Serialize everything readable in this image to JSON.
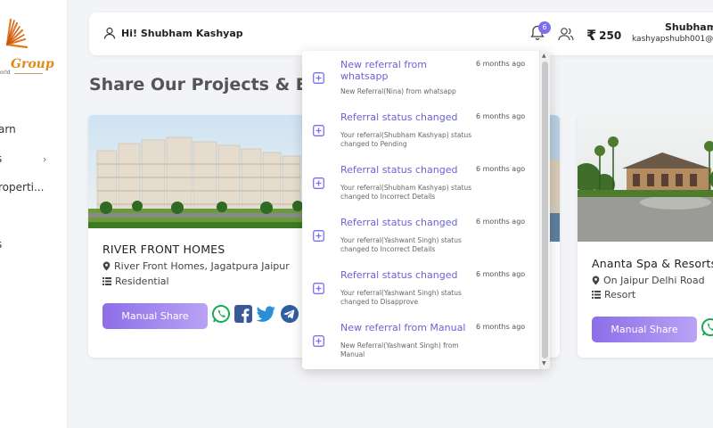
{
  "brand": {
    "logo_text": "Group",
    "logo_sub": "orld"
  },
  "sidebar": {
    "items": [
      {
        "label": "arn"
      },
      {
        "label": "s"
      },
      {
        "label": "roperti..."
      },
      {
        "label": "s"
      }
    ]
  },
  "header": {
    "greeting": "Hi! Shubham Kashyap",
    "notification_count": "6",
    "wallet_currency": "₹",
    "wallet_amount": "250",
    "user_name": "Shubham",
    "user_email": "kashyapshubh001@"
  },
  "page": {
    "title": "Share Our Projects & Earn"
  },
  "projects": [
    {
      "title": "RIVER FRONT HOMES",
      "location": "River Front Homes, Jagatpura Jaipur",
      "category": "Residential",
      "share_label": "Manual Share"
    },
    {
      "title": "Ananta Spa & Resorts",
      "location": "On Jaipur Delhi Road",
      "category": "Resort",
      "share_label": "Manual Share"
    }
  ],
  "notifications": [
    {
      "title": "New referral from whatsapp",
      "time": "6 months ago",
      "body": "New Referral(Nina) from whatsapp"
    },
    {
      "title": "Referral status changed",
      "time": "6 months ago",
      "body": "Your referral(Shubham Kashyap) status changed to Pending"
    },
    {
      "title": "Referral status changed",
      "time": "6 months ago",
      "body": "Your referral(Shubham Kashyap) status changed to Incorrect Details"
    },
    {
      "title": "Referral status changed",
      "time": "6 months ago",
      "body": "Your referral(Yashwant Singh) status changed to Incorrect Details"
    },
    {
      "title": "Referral status changed",
      "time": "6 months ago",
      "body": "Your referral(Yashwant Singh) status changed to Disapprove"
    },
    {
      "title": "New referral from Manual",
      "time": "6 months ago",
      "body": "New Referral(Yashwant Singh) from Manual"
    }
  ],
  "icons": {
    "user": "user-icon",
    "bell": "bell-icon",
    "users": "users-icon",
    "location": "location-pin-icon",
    "list": "list-icon",
    "whatsapp": "whatsapp-icon",
    "facebook": "facebook-icon",
    "twitter": "twitter-icon",
    "telegram": "telegram-icon",
    "notification": "plus-square-icon"
  },
  "colors": {
    "accent": "#7b6ff0",
    "button_start": "#8d6ee8",
    "button_end": "#b8a3f5",
    "whatsapp": "#25d366",
    "facebook": "#1877f2",
    "twitter": "#1da1f2",
    "telegram": "#2f76c9",
    "link": "#6b62d6"
  }
}
